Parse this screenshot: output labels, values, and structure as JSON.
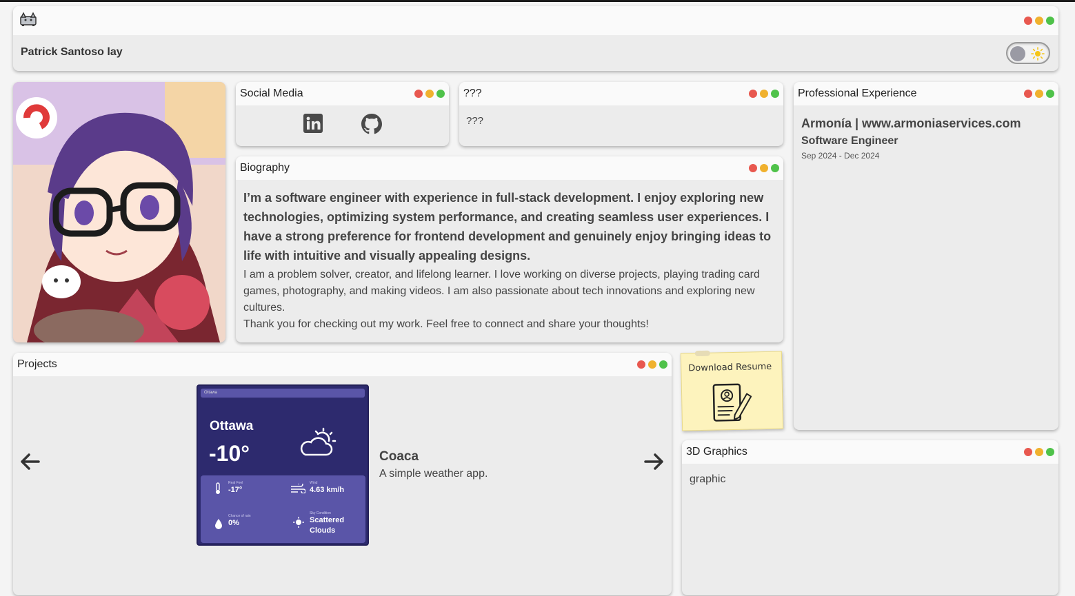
{
  "header": {
    "name": "Patrick Santoso lay",
    "logo_icon": "cat-icon",
    "theme_toggle_icon": "sun-icon"
  },
  "social": {
    "title": "Social Media",
    "links": [
      {
        "icon": "linkedin-icon"
      },
      {
        "icon": "github-icon"
      }
    ]
  },
  "mystery": {
    "title": "???",
    "body": "???"
  },
  "biography": {
    "title": "Biography",
    "lead": "I’m a software engineer with experience in full-stack development. I enjoy exploring new technologies, optimizing system performance, and creating seamless user experiences. I have a strong preference for frontend development and genuinely enjoy bringing ideas to life with intuitive and visually appealing designs.",
    "para1": "I am a problem solver, creator, and lifelong learner. I love working on diverse projects, playing trading card games, photography, and making videos. I am also passionate about tech innovations and exploring new cultures.",
    "para2": "Thank you for checking out my work. Feel free to connect and share your thoughts!"
  },
  "experience": {
    "title": "Professional Experience",
    "company": "Armonía | www.armoniaservices.com",
    "role": "Software Engineer",
    "dates": "Sep 2024 - Dec 2024"
  },
  "projects": {
    "title": "Projects",
    "current": {
      "name": "Coaca",
      "description": "A simple weather app.",
      "preview": {
        "bar": "Ottawa",
        "city": "Ottawa",
        "temp": "-10°",
        "real_feel_label": "Real Feel",
        "real_feel": "-17°",
        "wind_label": "Wind",
        "wind": "4.63 km/h",
        "rain_label": "Chance of rain",
        "rain": "0%",
        "sky_label": "Sky Condition",
        "sky": "Scattered Clouds"
      }
    }
  },
  "resume": {
    "label": "Download Resume"
  },
  "graphics": {
    "title": "3D Graphics",
    "body": "graphic"
  },
  "colors": {
    "dot_red": "#e8584f",
    "dot_yellow": "#f0b12e",
    "dot_green": "#4fc24a",
    "note_yellow": "#fdf3bd",
    "weather_card": "#2d2a6e"
  }
}
